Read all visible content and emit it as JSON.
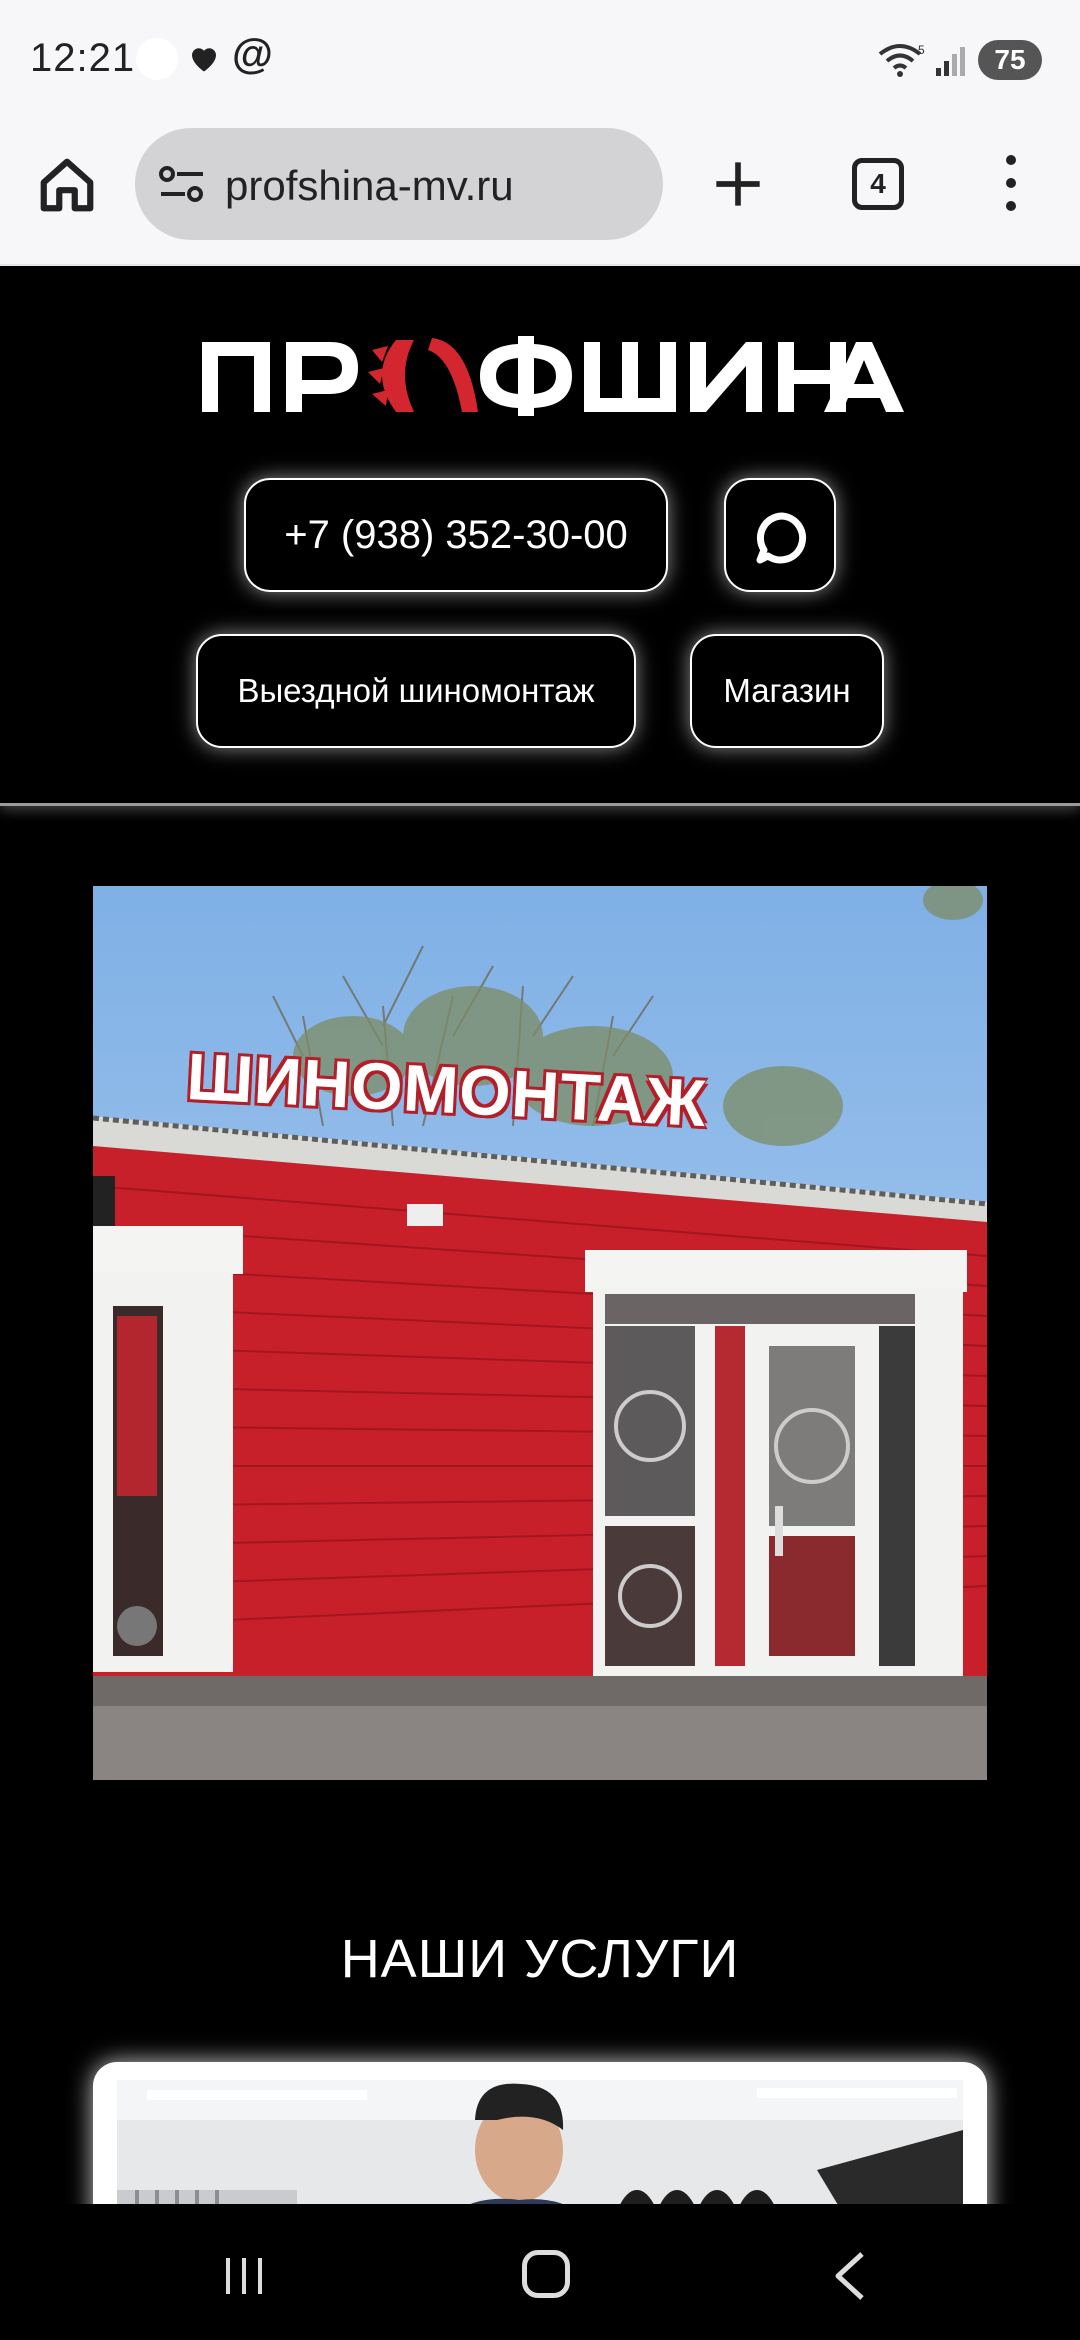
{
  "status_bar": {
    "time": "12:21",
    "battery": "75"
  },
  "browser": {
    "url": "profshina-mv.ru",
    "tab_count": "4"
  },
  "header": {
    "logo_text": "ПРОФШИНА",
    "phone": "+7 (938) 352-30-00",
    "service_button": "Выездной шиномонтаж",
    "shop_button": "Магазин"
  },
  "hero": {
    "sign_text": "ШИНОМОНТАЖ"
  },
  "services": {
    "title": "НАШИ УСЛУГИ"
  },
  "colors": {
    "background": "#000000",
    "brand_red": "#d4262e",
    "button_border": "#ffffff"
  }
}
